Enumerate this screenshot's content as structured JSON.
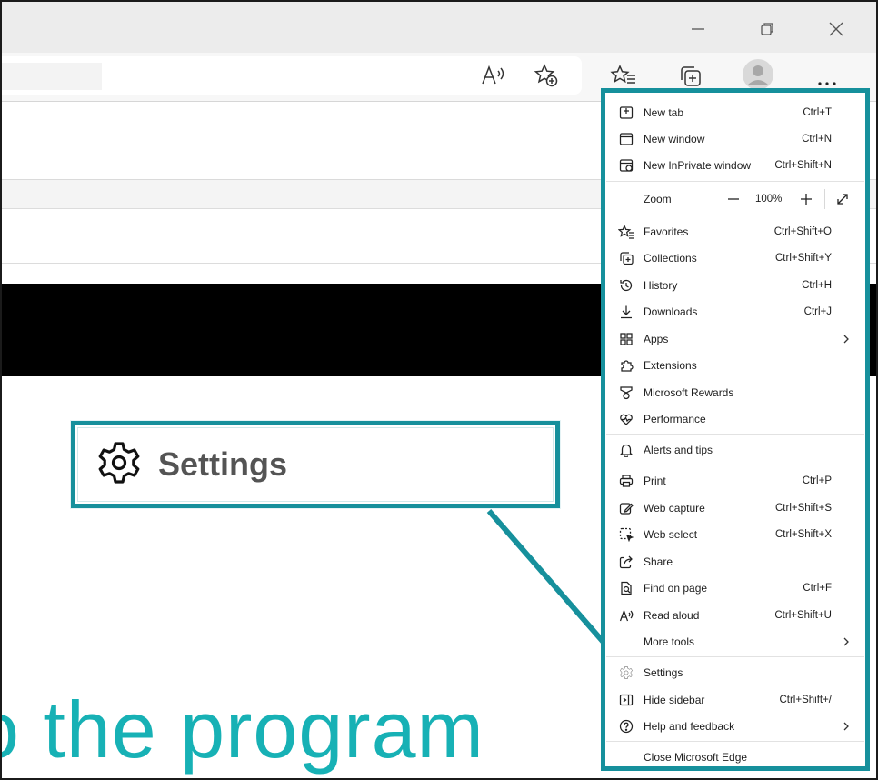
{
  "window": {
    "minimize_icon": "minimize-icon",
    "restore_icon": "restore-icon",
    "close_icon": "close-icon"
  },
  "toolbar": {
    "read_aloud_icon": "read-aloud-icon",
    "add_favorite_icon": "add-favorite-icon",
    "favorites_icon": "favorites-icon",
    "collections_icon": "collections-icon",
    "profile_icon": "profile-icon",
    "more_icon": "more-icon"
  },
  "page": {
    "bottom_text": "o the program"
  },
  "callout": {
    "label": "Settings",
    "icon": "gear-icon",
    "accent_color": "#16909c"
  },
  "menu": {
    "new_tab": {
      "label": "New tab",
      "shortcut": "Ctrl+T"
    },
    "new_window": {
      "label": "New window",
      "shortcut": "Ctrl+N"
    },
    "new_inprivate": {
      "label": "New InPrivate window",
      "shortcut": "Ctrl+Shift+N"
    },
    "zoom": {
      "label": "Zoom",
      "value": "100%"
    },
    "favorites": {
      "label": "Favorites",
      "shortcut": "Ctrl+Shift+O"
    },
    "collections": {
      "label": "Collections",
      "shortcut": "Ctrl+Shift+Y"
    },
    "history": {
      "label": "History",
      "shortcut": "Ctrl+H"
    },
    "downloads": {
      "label": "Downloads",
      "shortcut": "Ctrl+J"
    },
    "apps": {
      "label": "Apps"
    },
    "extensions": {
      "label": "Extensions"
    },
    "rewards": {
      "label": "Microsoft Rewards"
    },
    "performance": {
      "label": "Performance"
    },
    "alerts": {
      "label": "Alerts and tips"
    },
    "print": {
      "label": "Print",
      "shortcut": "Ctrl+P"
    },
    "web_capture": {
      "label": "Web capture",
      "shortcut": "Ctrl+Shift+S"
    },
    "web_select": {
      "label": "Web select",
      "shortcut": "Ctrl+Shift+X"
    },
    "share": {
      "label": "Share"
    },
    "find": {
      "label": "Find on page",
      "shortcut": "Ctrl+F"
    },
    "read_aloud": {
      "label": "Read aloud",
      "shortcut": "Ctrl+Shift+U"
    },
    "more_tools": {
      "label": "More tools"
    },
    "settings": {
      "label": "Settings"
    },
    "hide_sidebar": {
      "label": "Hide sidebar",
      "shortcut": "Ctrl+Shift+/"
    },
    "help": {
      "label": "Help and feedback"
    },
    "close": {
      "label": "Close Microsoft Edge"
    }
  }
}
